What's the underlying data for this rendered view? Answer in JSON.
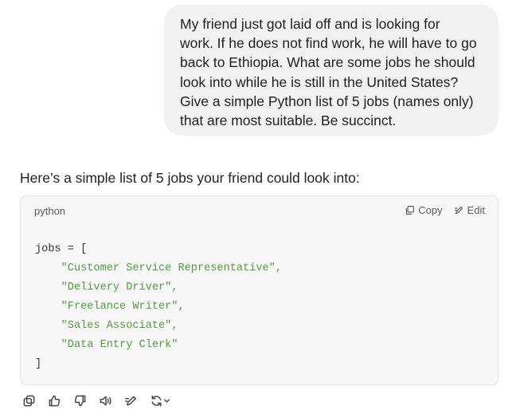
{
  "user_message": {
    "lines": [
      "My friend just got laid off and is looking for",
      "work. If he does not find work, he will have to go",
      "back to Ethiopia. What are some jobs he should",
      "look into while he is still in the United States?",
      "Give a simple Python list of 5 jobs (names only)",
      "that are most suitable. Be succinct."
    ]
  },
  "assistant": {
    "intro": "Here’s a simple list of 5 jobs your friend could look into:",
    "code_block": {
      "language": "python",
      "copy_label": "Copy",
      "edit_label": "Edit",
      "open_line": "jobs = [",
      "items": [
        "\"Customer Service Representative\",",
        "\"Delivery Driver\",",
        "\"Freelance Writer\",",
        "\"Sales Associate\",",
        "\"Data Entry Clerk\""
      ],
      "close_line": "]"
    }
  },
  "toolbar": {
    "icons": [
      "copy-icon",
      "thumbs-up-icon",
      "thumbs-down-icon",
      "read-aloud-icon",
      "edit-icon",
      "regenerate-icon"
    ]
  },
  "colors": {
    "bubble_bg": "#f1f1f1",
    "code_bg": "#f7f7f7",
    "string_color": "#4e9a3e"
  }
}
